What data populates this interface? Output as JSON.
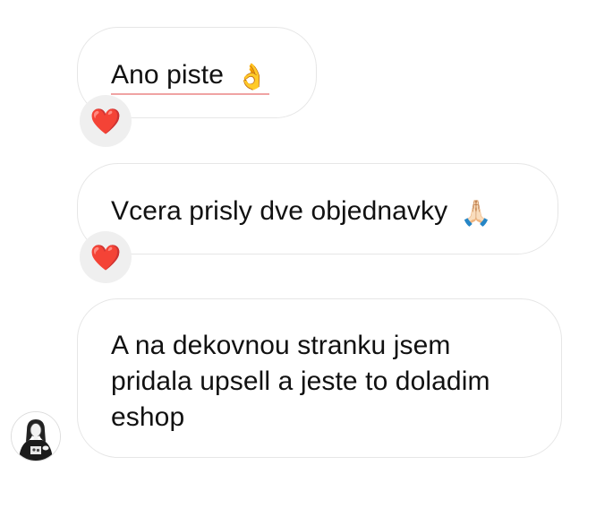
{
  "messages": [
    {
      "text": "Ano piste",
      "emoji": "👌",
      "emoji_icon": "ok-hand-emoji-icon",
      "reaction": "❤️",
      "reaction_icon": "red-heart-icon"
    },
    {
      "text": "Vcera prisly dve objednavky",
      "emoji": "🙏🏻",
      "emoji_icon": "folded-hands-emoji-icon",
      "reaction": "❤️",
      "reaction_icon": "red-heart-icon"
    },
    {
      "text": "A na dekovnou stranku jsem pridala upsell a jeste to doladim eshop"
    }
  ],
  "sender": {
    "avatar_icon": "user-avatar-icon"
  },
  "colors": {
    "bubble_border": "#e6e6e6",
    "reaction_bg": "#efefef",
    "spellcheck_underline": "#f0a3a3",
    "text": "#111111"
  }
}
